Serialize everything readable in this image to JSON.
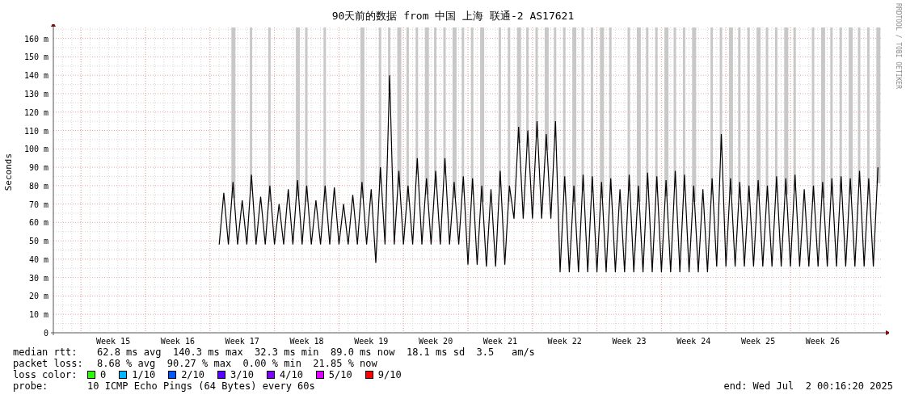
{
  "chart": {
    "chart_data": {
      "type": "line",
      "title": "90天前的数据 from 中国 上海 联通-2 AS17621",
      "ylabel": "Seconds",
      "ylim": [
        0,
        166
      ],
      "grid": true,
      "categories": [
        null,
        null,
        null,
        null,
        null,
        null,
        null,
        null,
        null,
        null,
        null,
        null,
        null,
        "Week 15",
        null,
        null,
        null,
        null,
        null,
        null,
        null,
        null,
        null,
        null,
        null,
        null,
        null,
        "Week 16",
        null,
        null,
        null,
        null,
        null,
        null,
        null,
        null,
        null,
        null,
        null,
        null,
        null,
        "Week 17",
        null,
        null,
        null,
        null,
        null,
        null,
        null,
        null,
        null,
        null,
        null,
        null,
        null,
        "Week 18",
        null,
        null,
        null,
        null,
        null,
        null,
        null,
        null,
        null,
        null,
        null,
        null,
        null,
        "Week 19",
        null,
        null,
        null,
        null,
        null,
        null,
        null,
        null,
        null,
        null,
        null,
        null,
        null,
        "Week 20",
        null,
        null,
        null,
        null,
        null,
        null,
        null,
        null,
        null,
        null,
        null,
        null,
        null,
        "Week 21",
        null,
        null,
        null,
        null,
        null,
        null,
        null,
        null,
        null,
        null,
        null,
        null,
        null,
        "Week 22",
        null,
        null,
        null,
        null,
        null,
        null,
        null,
        null,
        null,
        null,
        null,
        null,
        null,
        "Week 23",
        null,
        null,
        null,
        null,
        null,
        null,
        null,
        null,
        null,
        null,
        null,
        null,
        null,
        "Week 24",
        null,
        null,
        null,
        null,
        null,
        null,
        null,
        null,
        null,
        null,
        null,
        null,
        null,
        "Week 25",
        null,
        null,
        null,
        null,
        null,
        null,
        null,
        null,
        null,
        null,
        null,
        null,
        null,
        "Week 26",
        null,
        null,
        null,
        null,
        null,
        null,
        null,
        null,
        null,
        null,
        null,
        null
      ],
      "yticks": [
        {
          "value": 0,
          "label": "0"
        },
        {
          "value": 10,
          "label": "10 m"
        },
        {
          "value": 20,
          "label": "20 m"
        },
        {
          "value": 30,
          "label": "30 m"
        },
        {
          "value": 40,
          "label": "40 m"
        },
        {
          "value": 50,
          "label": "50 m"
        },
        {
          "value": 60,
          "label": "60 m"
        },
        {
          "value": 70,
          "label": "70 m"
        },
        {
          "value": 80,
          "label": "80 m"
        },
        {
          "value": 90,
          "label": "90 m"
        },
        {
          "value": 100,
          "label": "100 m"
        },
        {
          "value": 110,
          "label": "110 m"
        },
        {
          "value": 120,
          "label": "120 m"
        },
        {
          "value": 130,
          "label": "130 m"
        },
        {
          "value": 140,
          "label": "140 m"
        },
        {
          "value": 150,
          "label": "150 m"
        },
        {
          "value": 160,
          "label": "160 m"
        }
      ],
      "series": [
        {
          "color": "#000000",
          "values": [
            null,
            null,
            null,
            null,
            null,
            null,
            null,
            null,
            null,
            null,
            null,
            null,
            null,
            null,
            null,
            null,
            null,
            null,
            null,
            null,
            null,
            null,
            null,
            null,
            null,
            null,
            null,
            null,
            null,
            null,
            null,
            null,
            null,
            null,
            null,
            null,
            48,
            76,
            48,
            82,
            48,
            72,
            48,
            86,
            48,
            74,
            48,
            80,
            48,
            70,
            48,
            78,
            48,
            83,
            48,
            80,
            48,
            72,
            48,
            80,
            48,
            79,
            48,
            70,
            48,
            75,
            48,
            82,
            48,
            78,
            38,
            90,
            48,
            140,
            48,
            88,
            48,
            80,
            48,
            95,
            48,
            84,
            48,
            88,
            48,
            95,
            48,
            82,
            48,
            85,
            37,
            84,
            37,
            80,
            36,
            78,
            36,
            88,
            37,
            80,
            62,
            112,
            62,
            110,
            62,
            115,
            62,
            108,
            62,
            115,
            33,
            85,
            33,
            80,
            33,
            86,
            33,
            85,
            33,
            82,
            33,
            84,
            33,
            78,
            33,
            86,
            33,
            80,
            33,
            87,
            33,
            85,
            33,
            83,
            33,
            88,
            33,
            86,
            33,
            80,
            33,
            78,
            33,
            84,
            36,
            108,
            36,
            84,
            36,
            82,
            36,
            80,
            36,
            83,
            36,
            80,
            36,
            85,
            36,
            84,
            36,
            86,
            36,
            78,
            36,
            80,
            36,
            82,
            36,
            84,
            36,
            85,
            36,
            84,
            36,
            88,
            36,
            84,
            36,
            90
          ]
        }
      ]
    }
  },
  "credit": "RRDTOOL / TOBI OETIKER",
  "stats": [
    {
      "label": "median rtt:",
      "text": "62.8 ms avg  140.3 ms max  32.3 ms min  89.0 ms now  18.1 ms sd  3.5   am/s"
    },
    {
      "label": "packet loss:",
      "text": "8.68 % avg  90.27 % max  0.00 % min  21.85 % now"
    }
  ],
  "loss_colors": {
    "label": "loss color:",
    "items": [
      {
        "label": "0",
        "color": "#26ff00"
      },
      {
        "label": "1/10",
        "color": "#00b8ff"
      },
      {
        "label": "2/10",
        "color": "#0059ff"
      },
      {
        "label": "3/10",
        "color": "#5e00ff"
      },
      {
        "label": "4/10",
        "color": "#7e00ff"
      },
      {
        "label": "5/10",
        "color": "#dd00ff"
      },
      {
        "label": "9/10",
        "color": "#ff0000"
      }
    ]
  },
  "probe": {
    "label": "probe:",
    "text": "10 ICMP Echo Pings (64 Bytes) every 60s"
  },
  "end": "end: Wed Jul  2 00:16:20 2025"
}
